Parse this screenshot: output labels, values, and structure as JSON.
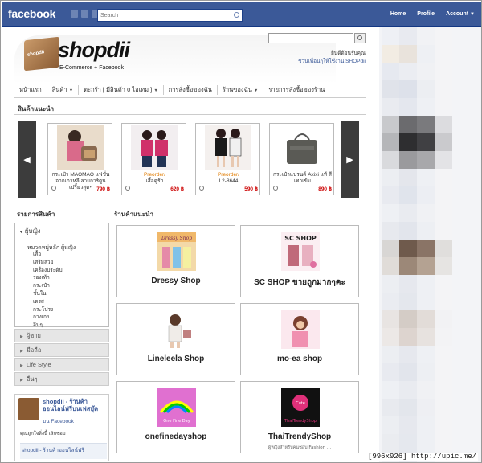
{
  "fbbar": {
    "brand": "facebook",
    "search_placeholder": "Search",
    "nav": [
      "Home",
      "Profile",
      "Account"
    ],
    "account_caret": "▼"
  },
  "site": {
    "logo_text": "shopdii",
    "logo_bag_text": "shopdii",
    "tagline": "E-Commerce + Facebook",
    "welcome_line1": "ยินดีต้อนรับคุณ",
    "welcome_line2": "ชวนเพื่อนๆให้ใช้งาน SHOPdii",
    "nav": [
      {
        "label": "หน้าแรก",
        "dropdown": false
      },
      {
        "label": "สินค้า",
        "dropdown": true
      },
      {
        "label": "ตะกร้า [ มีสินค้า 0 ไอเทม ]",
        "dropdown": true
      },
      {
        "label": "การสั่งซื้อของฉัน",
        "dropdown": false
      },
      {
        "label": "ร้านของฉัน",
        "dropdown": true
      },
      {
        "label": "รายการสั่งซื้อของร้าน",
        "dropdown": false
      }
    ]
  },
  "featured": {
    "title": "สินค้าแนะนำ",
    "prev": "◀",
    "next": "▶",
    "products": [
      {
        "pre": "",
        "name": "กระเป๋า MAOMAO แฟชั่นจากเกาหลี ลายการ์ตูนเปรี้ยวสุดๆ",
        "price": "790 ฿"
      },
      {
        "pre": "Preorder/",
        "name": "เสื้อคู่รัก",
        "price": "620 ฿"
      },
      {
        "pre": "Preorder/",
        "name": "L2-8644",
        "price": "590 ฿"
      },
      {
        "pre": "",
        "name": "กระเป๋าแบรนด์ Axixi แท้ สีเทาเข้ม",
        "price": "890 ฿"
      }
    ]
  },
  "categories": {
    "title": "รายการสินค้า",
    "open_group": "ผู้หญิง",
    "sub_title": "หมวดหมู่หลัก ผู้หญิง",
    "items": [
      "เสื้อ",
      "เสริมสวย",
      "เครื่องประดับ",
      "รองเท้า",
      "กระเป๋า",
      "ชั้นใน",
      "เดรส",
      "กระโปรง",
      "กางเกง",
      "อื่นๆ"
    ],
    "collapsed": [
      "ผู้ชาย",
      "มือถือ",
      "Life Style",
      "อื่นๆ"
    ]
  },
  "fanbox": {
    "title": "shopdii - ร้านค้าออนไลน์ฟรีบนเฟสบุ๊ค",
    "on": "บน Facebook",
    "likes": "คุณถูกใจสิ่งนี้ เลิกชอบ",
    "post": "shopdii - ร้านค้าออนไลน์ฟรี"
  },
  "shops": {
    "title": "ร้านค้าแนะนำ",
    "items": [
      {
        "name": "Dressy Shop",
        "desc": ""
      },
      {
        "name": "SC SHOP ขายถูกมากๆคะ",
        "desc": ""
      },
      {
        "name": "Lineleela Shop",
        "desc": ""
      },
      {
        "name": "mo-ea shop",
        "desc": ""
      },
      {
        "name": "onefinedayshop",
        "desc": ""
      },
      {
        "name": "ThaiTrendyShop",
        "desc": "ผู้หญิงสำหรับคนชอบ Fashion ... "
      }
    ]
  },
  "watermark": "[996x926] http://upic.me/"
}
